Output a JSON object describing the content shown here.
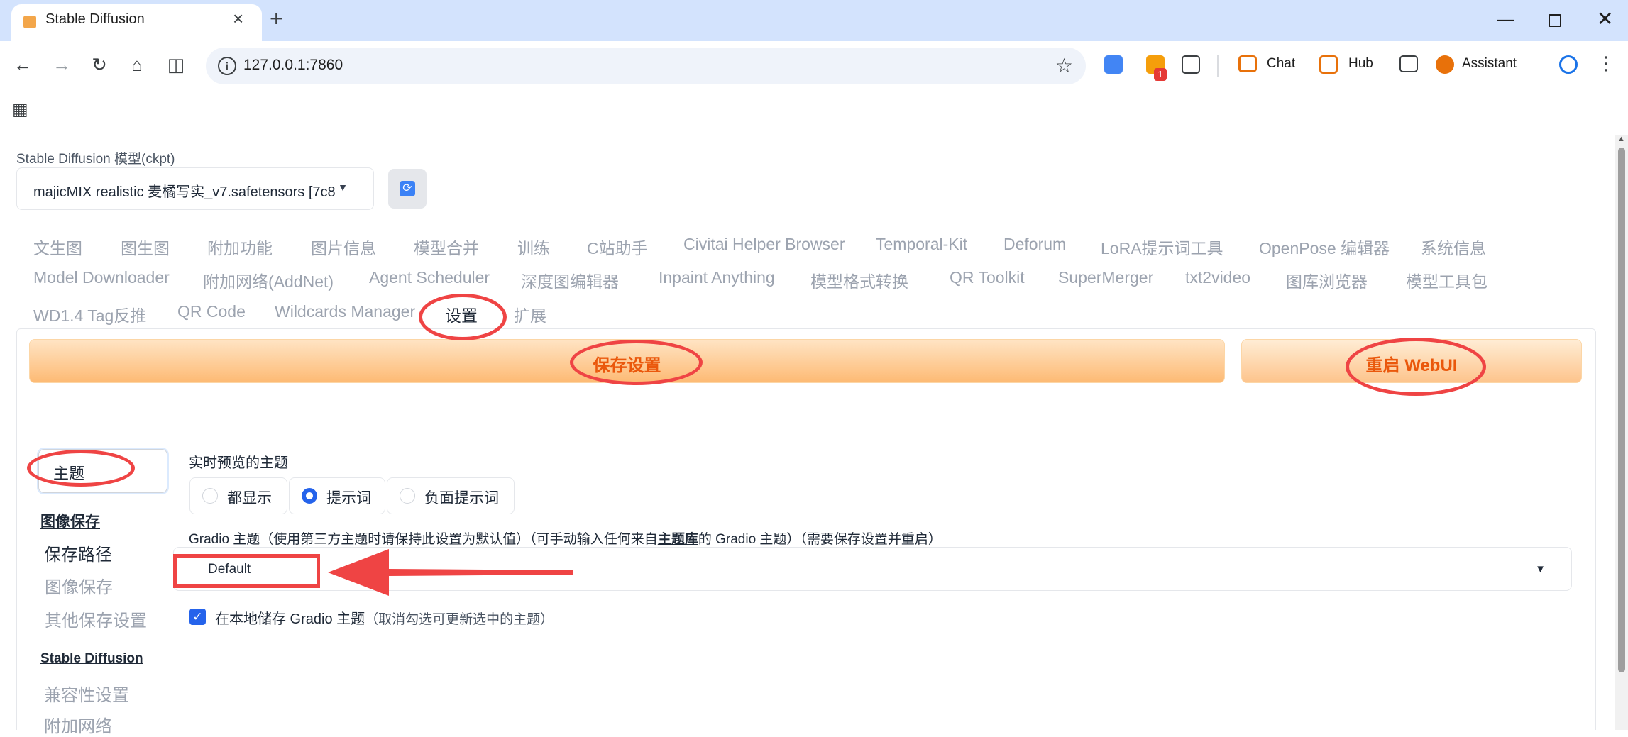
{
  "browser": {
    "tab_title": "Stable Diffusion",
    "url": "127.0.0.1:7860",
    "ext_badge": "1",
    "toolbar_chat": "Chat",
    "toolbar_hub": "Hub",
    "toolbar_assistant": "Assistant"
  },
  "page": {
    "ckpt_label": "Stable Diffusion 模型(ckpt)",
    "ckpt_value": "majicMIX realistic 麦橘写实_v7.safetensors [7c8",
    "tabs_row1": [
      "文生图",
      "图生图",
      "附加功能",
      "图片信息",
      "模型合并",
      "训练",
      "C站助手",
      "Civitai Helper Browser",
      "Temporal-Kit",
      "Deforum",
      "LoRA提示词工具",
      "OpenPose 编辑器",
      "系统信息"
    ],
    "tabs_row2": [
      "Model Downloader",
      "附加网络(AddNet)",
      "Agent Scheduler",
      "深度图编辑器",
      "Inpaint Anything",
      "模型格式转换",
      "QR Toolkit",
      "SuperMerger",
      "txt2video",
      "图库浏览器",
      "模型工具包"
    ],
    "tabs_row3": [
      "WD1.4 Tag反推",
      "QR Code",
      "Wildcards Manager",
      "设置",
      "扩展"
    ],
    "save_button": "保存设置",
    "restart_button": "重启 WebUI",
    "search_value": "主题",
    "sidebar": {
      "h1": "图像保存",
      "i1": "保存路径",
      "i2": "图像保存",
      "i3": "其他保存设置",
      "h2": "Stable Diffusion",
      "i4": "兼容性设置",
      "i5": "附加网络"
    },
    "live_preview_label": "实时预览的主题",
    "radio_options": [
      "都显示",
      "提示词",
      "负面提示词"
    ],
    "radio_selected": "提示词",
    "gradio_label_a": "Gradio 主题（使用第三方主题时请保持此设置为默认值）（可手动输入任何来自",
    "gradio_label_link": "主题库",
    "gradio_label_b": "的 Gradio 主题）（需要保存设置并重启）",
    "gradio_theme_value": "Default",
    "checkbox_label": "在本地储存 Gradio 主题",
    "checkbox_hint": "（取消勾选可更新选中的主题）",
    "checkbox_checked": true
  },
  "colors": {
    "annotation": "#ef4444",
    "accent_orange": "#ea580c",
    "accent_blue": "#2563eb"
  }
}
